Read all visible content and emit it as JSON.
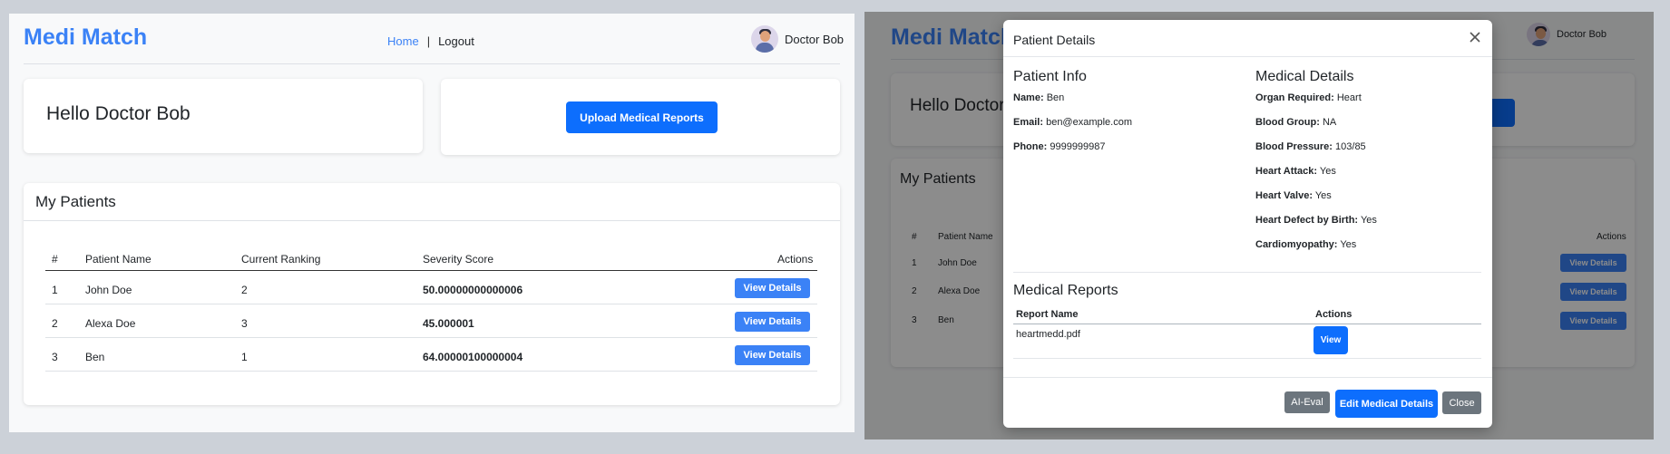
{
  "app": {
    "brand": "Medi Match"
  },
  "nav": {
    "home": "Home",
    "separator": "|",
    "logout": "Logout"
  },
  "user": {
    "name": "Doctor Bob",
    "avatar_icon": "doctor-avatar-icon"
  },
  "dashboard": {
    "greeting": "Hello Doctor Bob",
    "upload_label": "Upload Medical Reports",
    "patients_title": "My Patients",
    "columns": [
      "#",
      "Patient Name",
      "Current Ranking",
      "Severity Score",
      "Actions"
    ],
    "rows": [
      {
        "idx": "1",
        "name": "John Doe",
        "ranking": "2",
        "score": "50.00000000000006",
        "action": "View Details"
      },
      {
        "idx": "2",
        "name": "Alexa Doe",
        "ranking": "3",
        "score": "45.000001",
        "action": "View Details"
      },
      {
        "idx": "3",
        "name": "Ben",
        "ranking": "1",
        "score": "64.00000100000004",
        "action": "View Details"
      }
    ]
  },
  "modal": {
    "title": "Patient Details",
    "patient_info_title": "Patient Info",
    "medical_details_title": "Medical Details",
    "patient_info": [
      {
        "label": "Name:",
        "value": "Ben"
      },
      {
        "label": "Email:",
        "value": "ben@example.com"
      },
      {
        "label": "Phone:",
        "value": "9999999987"
      }
    ],
    "medical_details": [
      {
        "label": "Organ Required:",
        "value": "Heart"
      },
      {
        "label": "Blood Group:",
        "value": "NA"
      },
      {
        "label": "Blood Pressure:",
        "value": "103/85"
      },
      {
        "label": "Heart Attack:",
        "value": "Yes"
      },
      {
        "label": "Heart Valve:",
        "value": "Yes"
      },
      {
        "label": "Heart Defect by Birth:",
        "value": "Yes"
      },
      {
        "label": "Cardiomyopathy:",
        "value": "Yes"
      }
    ],
    "reports_title": "Medical Reports",
    "report_columns": [
      "Report Name",
      "Actions"
    ],
    "reports": [
      {
        "name": "heartmedd.pdf",
        "action": "View"
      }
    ],
    "footer": {
      "ai_eval": "AI-Eval",
      "edit": "Edit Medical Details",
      "close": "Close"
    }
  },
  "colors": {
    "brand": "#3b82f6",
    "primary": "#0d6efd",
    "secondary": "#6c757d"
  }
}
